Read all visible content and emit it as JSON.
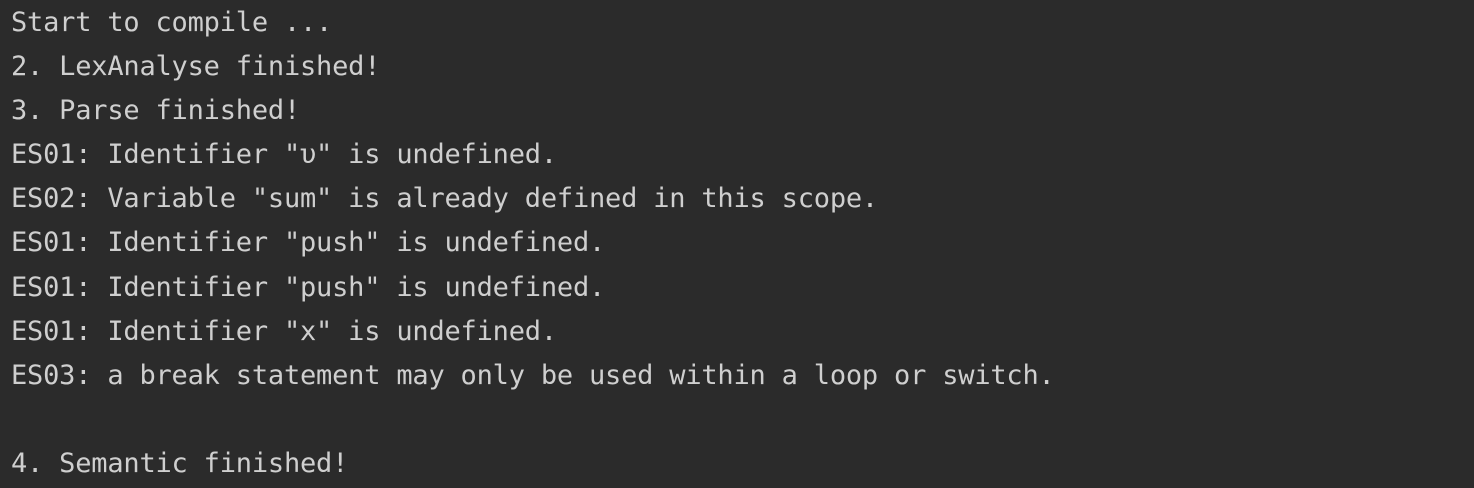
{
  "console": {
    "background_color": "#2b2b2b",
    "text_color": "#cfcfcf",
    "lines": [
      "Start to compile ...",
      "2. LexAnalyse finished!",
      "3. Parse finished!",
      "ES01: Identifier \"υ\" is undefined.",
      "ES02: Variable \"sum\" is already defined in this scope.",
      "ES01: Identifier \"push\" is undefined.",
      "ES01: Identifier \"push\" is undefined.",
      "ES01: Identifier \"x\" is undefined.",
      "ES03: a break statement may only be used within a loop or switch.",
      "",
      "4. Semantic finished!"
    ]
  }
}
